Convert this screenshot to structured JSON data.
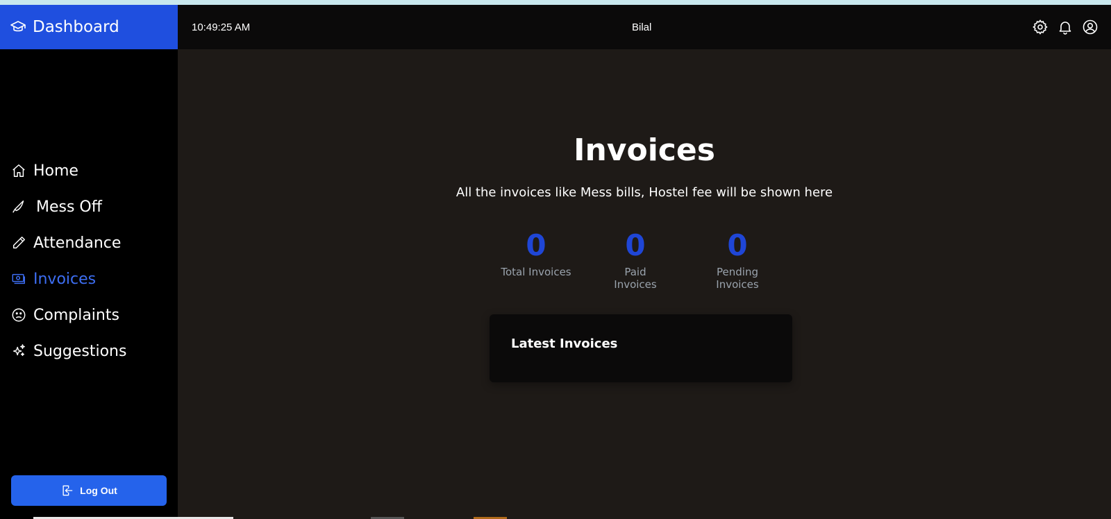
{
  "brand": {
    "title": "Dashboard",
    "icon": "graduation-cap-icon"
  },
  "topbar": {
    "time": "10:49:25 AM",
    "user": "Bilal",
    "icons": [
      "gear-icon",
      "bell-icon",
      "user-circle-icon"
    ]
  },
  "sidebar": {
    "items": [
      {
        "label": "Home",
        "icon": "home-icon"
      },
      {
        "label": "Mess Off",
        "icon": "knife-icon"
      },
      {
        "label": "Attendance",
        "icon": "pencil-icon"
      },
      {
        "label": "Invoices",
        "icon": "cash-icon",
        "active": true
      },
      {
        "label": "Complaints",
        "icon": "sad-face-icon"
      },
      {
        "label": "Suggestions",
        "icon": "sparkles-icon"
      }
    ],
    "logout_label": "Log Out"
  },
  "main": {
    "title": "Invoices",
    "subtitle": "All the invoices like Mess bills, Hostel fee will be shown here",
    "stats": [
      {
        "value": "0",
        "label": "Total Invoices"
      },
      {
        "value": "0",
        "label": "Paid Invoices"
      },
      {
        "value": "0",
        "label": "Pending Invoices"
      }
    ],
    "card_title": "Latest Invoices"
  },
  "colors": {
    "accent": "#1f4fdf",
    "active_nav": "#3d6ef3",
    "stat_number": "#1f46d6",
    "background": "#1e1a17"
  }
}
